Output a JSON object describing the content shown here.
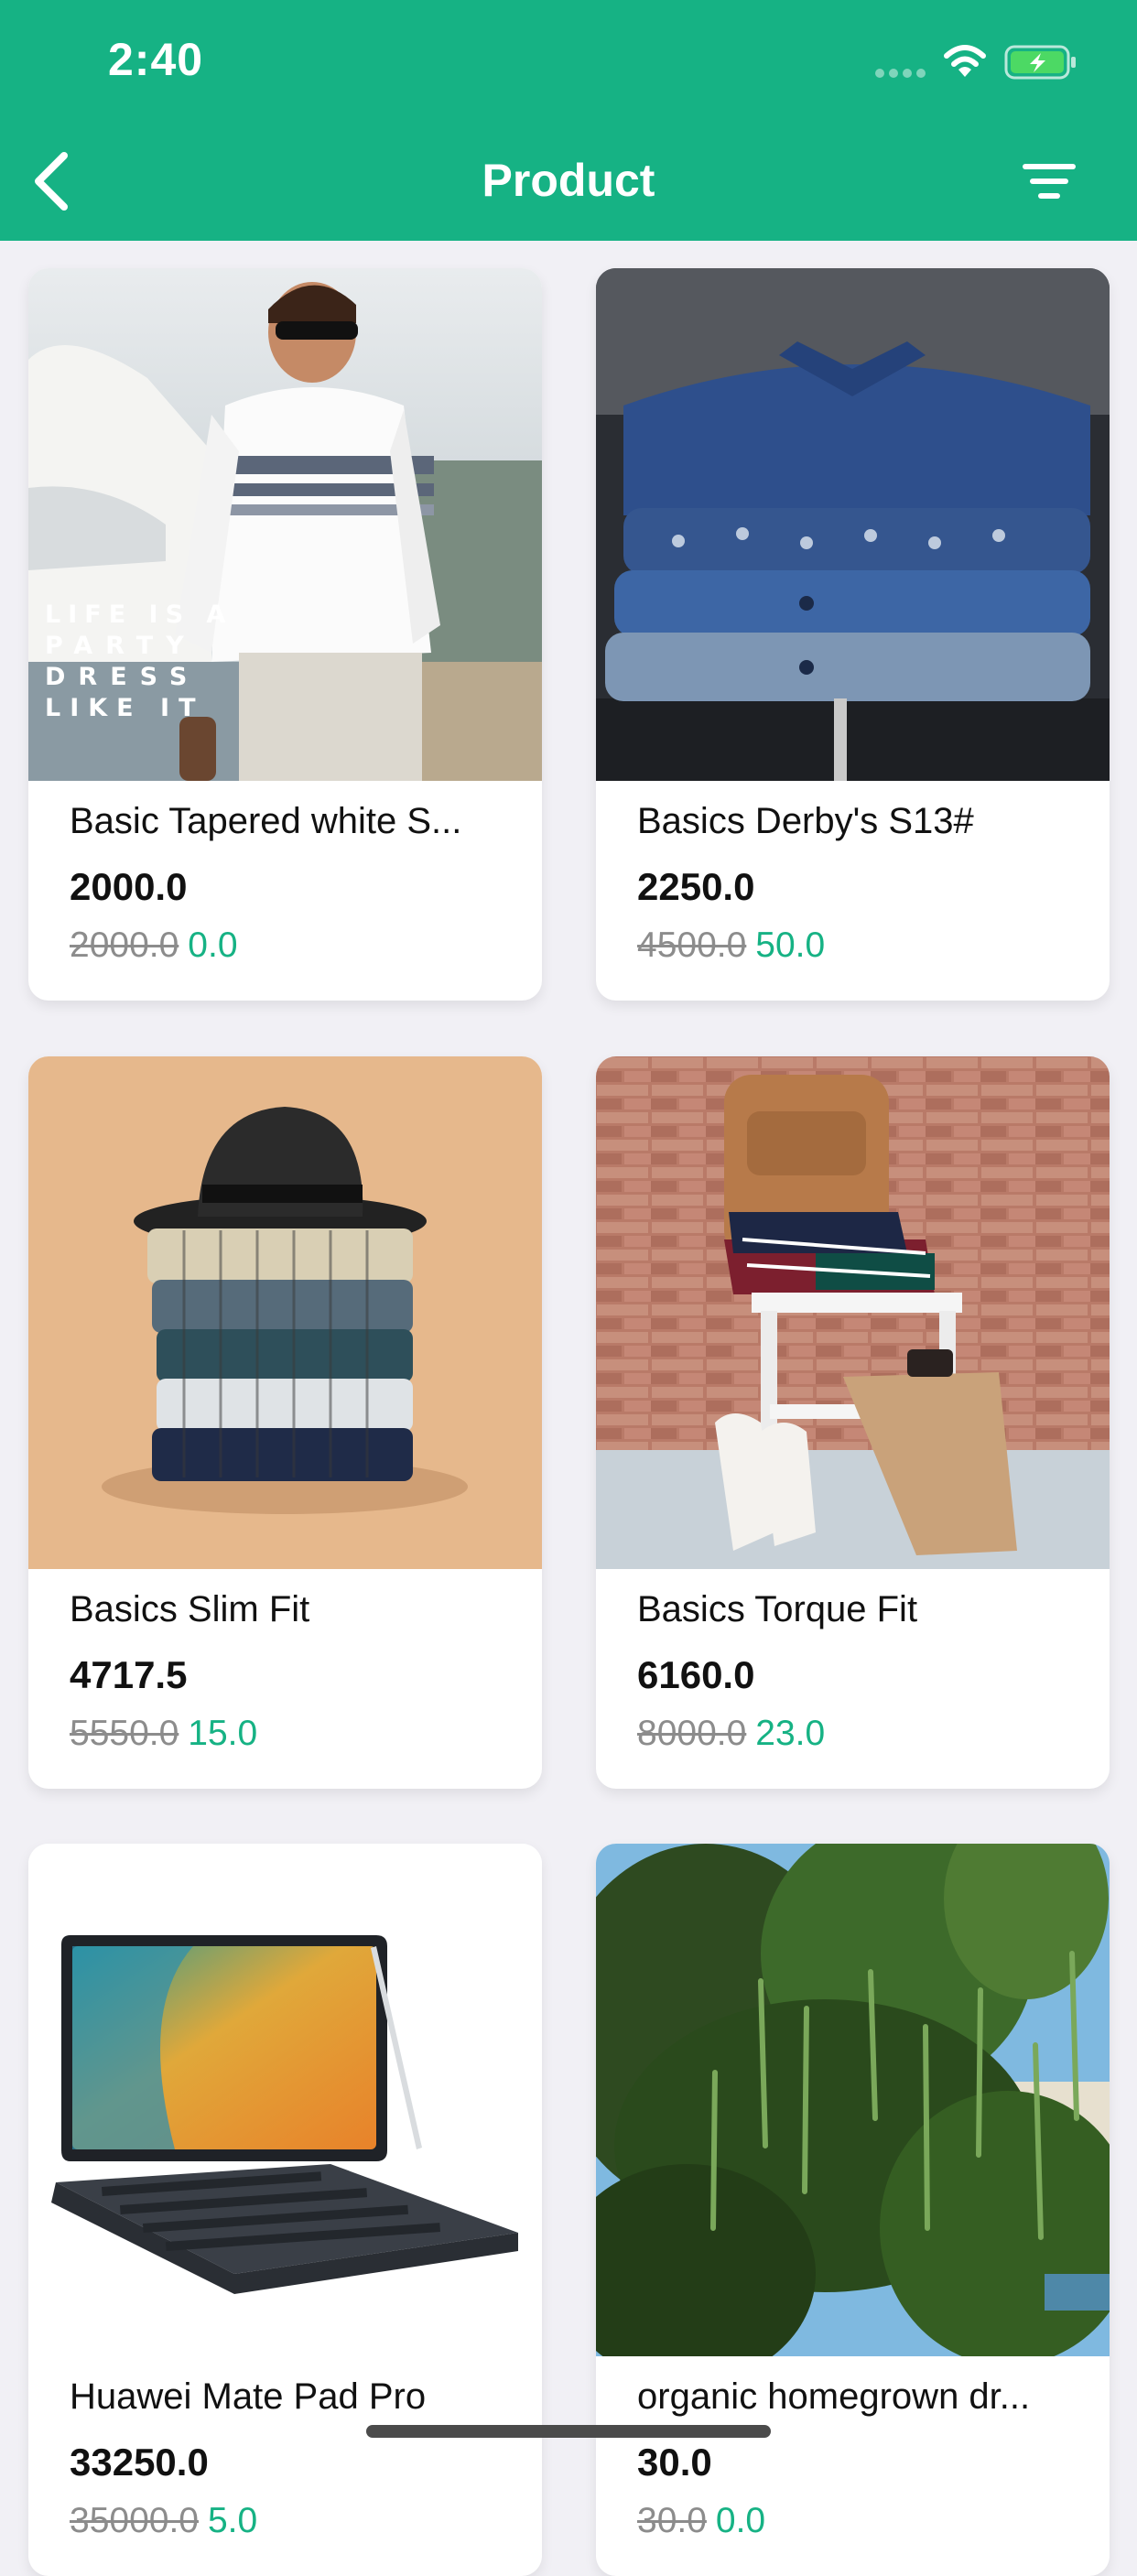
{
  "status_bar": {
    "time": "2:40"
  },
  "nav": {
    "title": "Product",
    "back_icon": "chevron-left-icon",
    "filter_icon": "filter-icon"
  },
  "colors": {
    "brand": "#16b284",
    "background": "#f1f0f5",
    "old_price": "#8c8c8c"
  },
  "products": [
    {
      "name": "Basic Tapered white S...",
      "price": "2000.0",
      "original_price": "2000.0",
      "discount": "0.0",
      "image_text": "LIFE IS A PARTY DRESS LIKE IT"
    },
    {
      "name": "Basics Derby's S13#",
      "price": "2250.0",
      "original_price": "4500.0",
      "discount": "50.0"
    },
    {
      "name": "Basics Slim Fit",
      "price": "4717.5",
      "original_price": "5550.0",
      "discount": "15.0"
    },
    {
      "name": "Basics Torque Fit",
      "price": "6160.0",
      "original_price": "8000.0",
      "discount": "23.0"
    },
    {
      "name": "Huawei Mate Pad Pro",
      "price": "33250.0",
      "original_price": "35000.0",
      "discount": "5.0"
    },
    {
      "name": "organic homegrown dr...",
      "price": "30.0",
      "original_price": "30.0",
      "discount": "0.0"
    }
  ]
}
